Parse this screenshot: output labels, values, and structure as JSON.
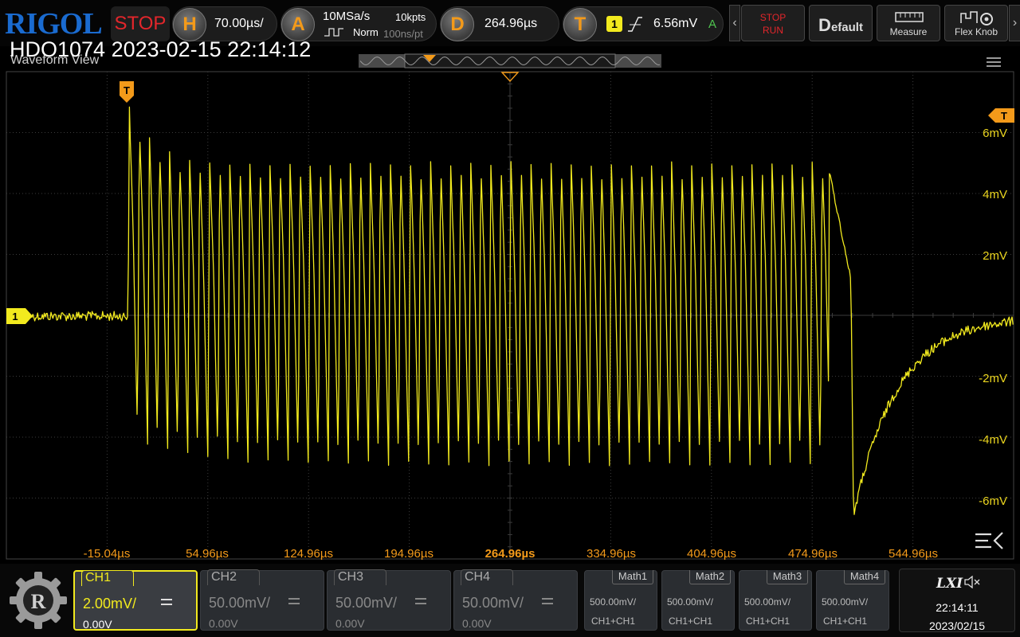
{
  "brand": "RIGOL",
  "run_status": "STOP",
  "horizontal": {
    "label": "H",
    "timebase": "70.00µs/"
  },
  "acquire": {
    "label": "A",
    "sample_rate": "10MSa/s",
    "memory_depth": "10kpts",
    "mode": "Norm",
    "resolution": "100ns/pt"
  },
  "delay": {
    "label": "D",
    "value": "264.96µs"
  },
  "trigger": {
    "label": "T",
    "source": "1",
    "level": "6.56mV",
    "status": "A"
  },
  "toolbar": {
    "stop_run_top": "STOP",
    "stop_run_bottom": "RUN",
    "default_first": "D",
    "default_rest": "efault",
    "measure": "Measure",
    "flex_knob": "Flex Knob"
  },
  "overlay_caption": "HDO1074 2023-02-15 22:14:12",
  "waveform_view": {
    "title": "Waveform View",
    "trigger_marker": "T",
    "channel_marker": "1",
    "y_ticks": [
      "6mV",
      "4mV",
      "2mV",
      "-2mV",
      "-4mV",
      "-6mV"
    ],
    "x_ticks": [
      "-15.04µs",
      "54.96µs",
      "124.96µs",
      "194.96µs",
      "264.96µs",
      "334.96µs",
      "404.96µs",
      "474.96µs",
      "544.96µs"
    ]
  },
  "channels": [
    {
      "name": "CH1",
      "scale": "2.00mV/",
      "offset": "0.00V",
      "active": true
    },
    {
      "name": "CH2",
      "scale": "50.00mV/",
      "offset": "0.00V",
      "active": false
    },
    {
      "name": "CH3",
      "scale": "50.00mV/",
      "offset": "0.00V",
      "active": false
    },
    {
      "name": "CH4",
      "scale": "50.00mV/",
      "offset": "0.00V",
      "active": false
    }
  ],
  "math": [
    {
      "name": "Math1",
      "scale": "500.00mV/",
      "source": "CH1+CH1"
    },
    {
      "name": "Math2",
      "scale": "500.00mV/",
      "source": "CH1+CH1"
    },
    {
      "name": "Math3",
      "scale": "500.00mV/",
      "source": "CH1+CH1"
    },
    {
      "name": "Math4",
      "scale": "500.00mV/",
      "source": "CH1+CH1"
    }
  ],
  "status": {
    "lxi": "LXI",
    "time": "22:14:11",
    "date": "2023/02/15"
  },
  "colors": {
    "ch1": "#f2ea1e",
    "accent": "#f39a1a",
    "stop": "#e3262b",
    "brand": "#1a6bd0",
    "grid": "#3c3c3c"
  }
}
